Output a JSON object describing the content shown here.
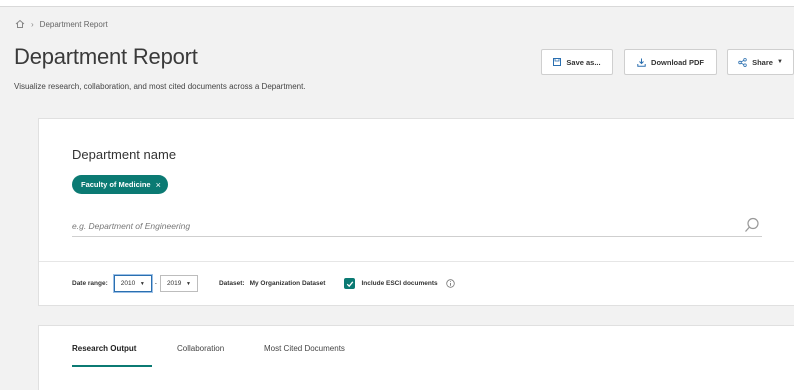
{
  "breadcrumb": {
    "current": "Department Report"
  },
  "page": {
    "title": "Department Report",
    "subtitle": "Visualize research, collaboration, and most cited documents across a Department."
  },
  "toolbar": {
    "save_label": "Save as...",
    "download_label": "Download PDF",
    "share_label": "Share"
  },
  "department": {
    "label": "Department name",
    "selected_chip": "Faculty of Medicine",
    "input_placeholder": "e.g. Department of Engineering",
    "input_value": ""
  },
  "filters": {
    "date_range_label": "Date range:",
    "start_year": "2010",
    "end_year": "2019",
    "dataset_label": "Dataset:",
    "dataset_value": "My Organization Dataset",
    "esci_label": "Include ESCI documents",
    "esci_checked": true
  },
  "tabs": [
    {
      "label": "Research Output",
      "active": true
    },
    {
      "label": "Collaboration",
      "active": false
    },
    {
      "label": "Most Cited Documents",
      "active": false
    }
  ],
  "colors": {
    "accent": "#0b7a73",
    "background": "#f2f2f2",
    "focus": "#2a6fb0"
  },
  "icons": {
    "home": "home-icon",
    "search": "search-icon",
    "info": "info-icon",
    "share": "share-icon",
    "download": "download-icon",
    "save": "save-icon"
  }
}
